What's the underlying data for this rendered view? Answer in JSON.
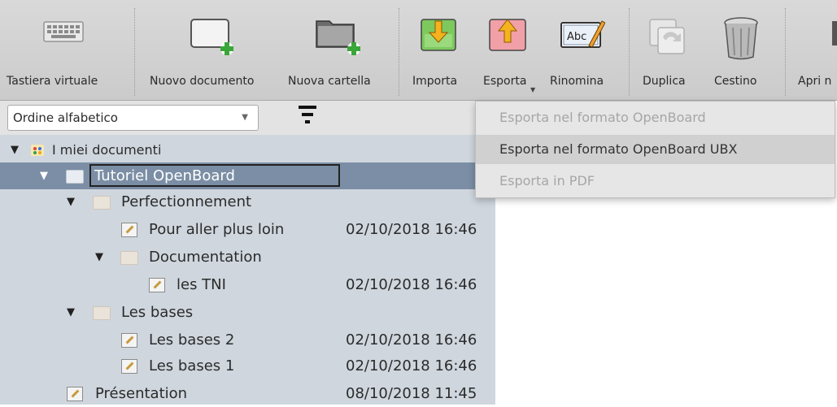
{
  "toolbar": {
    "items": [
      {
        "label": "Tastiera virtuale",
        "icon": "keyboard-icon"
      },
      {
        "label": "Nuovo documento",
        "icon": "new-document-icon"
      },
      {
        "label": "Nuova cartella",
        "icon": "new-folder-icon"
      },
      {
        "label": "Importa",
        "icon": "import-icon"
      },
      {
        "label": "Esporta",
        "icon": "export-icon"
      },
      {
        "label": "Rinomina",
        "icon": "rename-icon"
      },
      {
        "label": "Duplica",
        "icon": "duplicate-icon"
      },
      {
        "label": "Cestino",
        "icon": "trash-icon"
      },
      {
        "label": "Apri n",
        "icon": "open-icon"
      }
    ]
  },
  "sort": {
    "selected": "Ordine alfabetico"
  },
  "tree": {
    "root": "I miei documenti",
    "rows": [
      {
        "label": "Tutoriel OpenBoard",
        "date": ""
      },
      {
        "label": "Perfectionnement",
        "date": ""
      },
      {
        "label": "Pour aller plus loin",
        "date": "02/10/2018 16:46"
      },
      {
        "label": "Documentation",
        "date": ""
      },
      {
        "label": "les TNI",
        "date": "02/10/2018 16:46"
      },
      {
        "label": "Les bases",
        "date": ""
      },
      {
        "label": "Les bases 2",
        "date": "02/10/2018 16:46"
      },
      {
        "label": "Les bases 1",
        "date": "02/10/2018 16:46"
      },
      {
        "label": "Présentation",
        "date": "08/10/2018 11:45"
      }
    ]
  },
  "export_menu": {
    "items": [
      {
        "label": "Esporta nel formato OpenBoard",
        "state": "disabled"
      },
      {
        "label": "Esporta nel formato OpenBoard UBX",
        "state": "highlighted"
      },
      {
        "label": "Esporta in PDF",
        "state": "disabled"
      }
    ]
  },
  "colors": {
    "accent_import": "#7dc95e",
    "accent_export": "#f2a0a8",
    "selection": "#7b8ea5",
    "tree_bg": "#cfd6de"
  }
}
